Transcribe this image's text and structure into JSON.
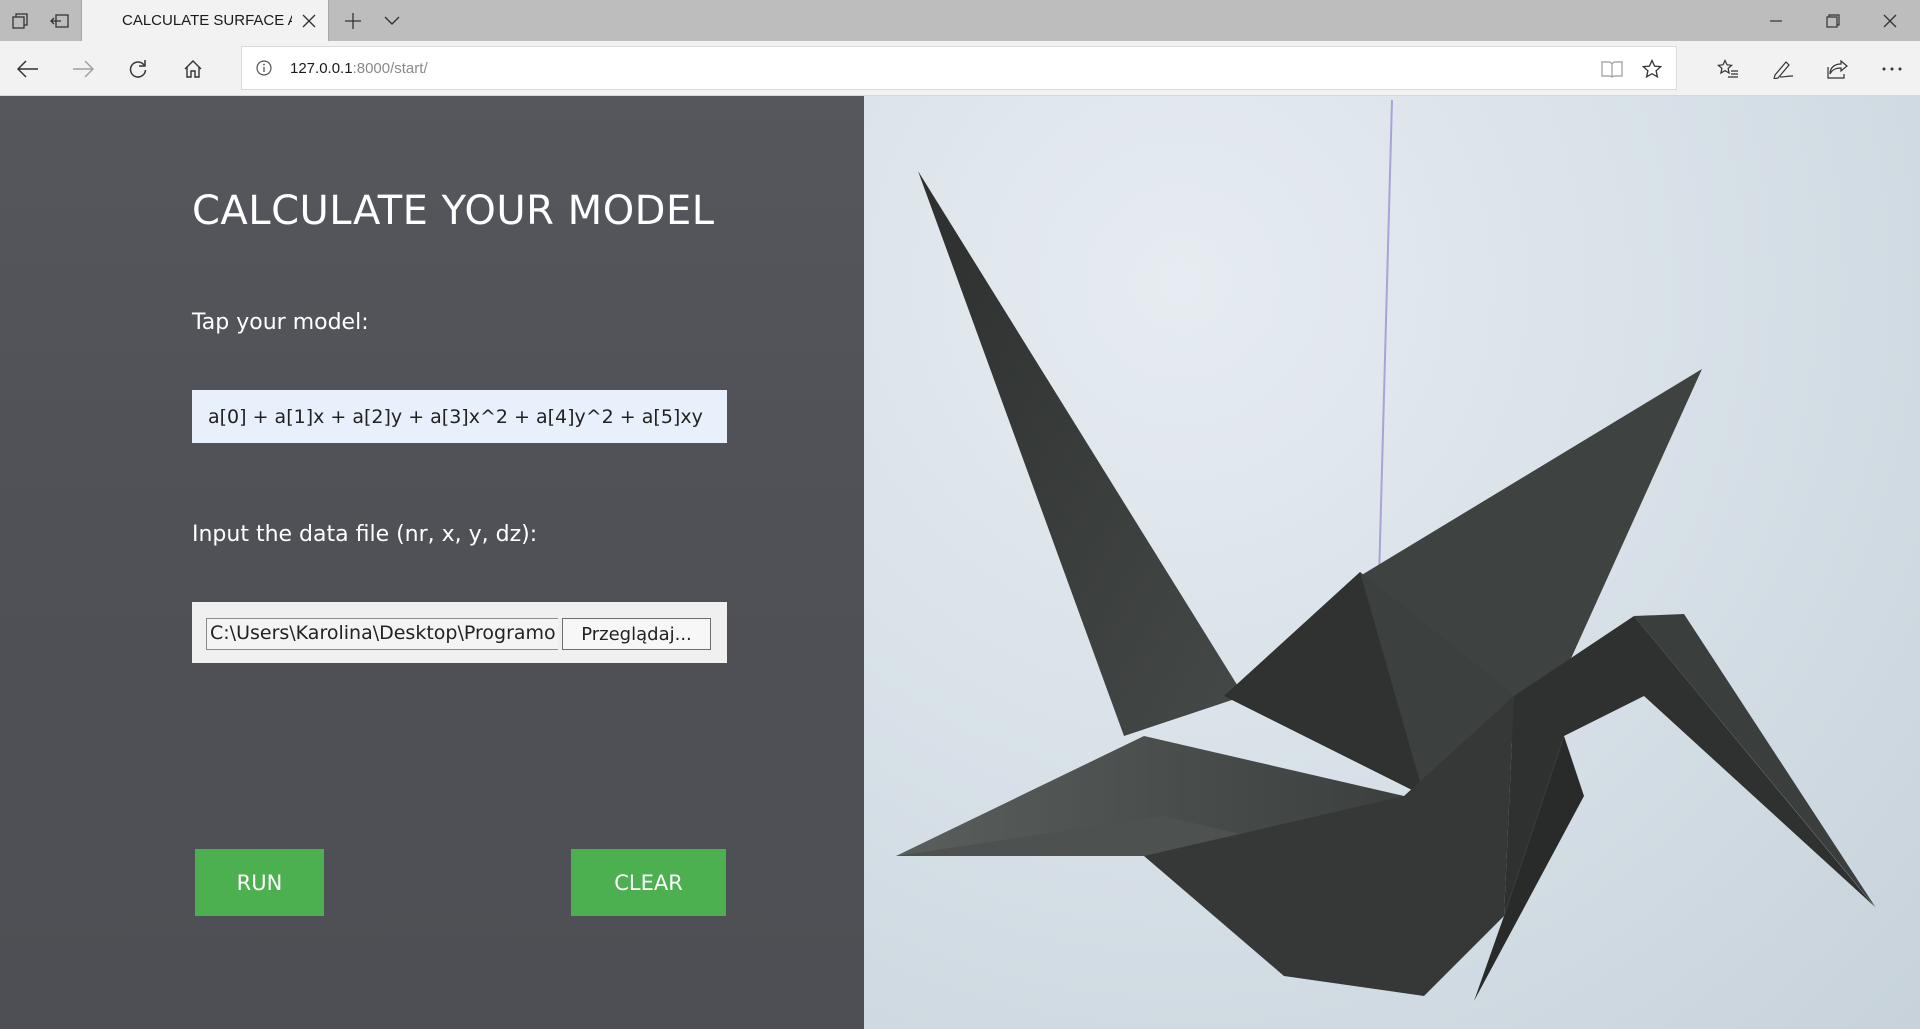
{
  "browser": {
    "tab_title": "CALCULATE SURFACE A",
    "url_host": "127.0.0.1",
    "url_rest": ":8000/start/",
    "icons": {
      "tab_actions": "tab-actions-icon",
      "set_aside": "set-aside-tabs-icon",
      "new_tab": "plus-icon",
      "tab_preview": "chevron-down-icon",
      "minimize": "minimize-icon",
      "restore": "restore-icon",
      "close": "close-icon",
      "back": "back-arrow-icon",
      "forward": "forward-arrow-icon",
      "refresh": "refresh-icon",
      "home": "home-icon",
      "info": "info-icon",
      "reading_view": "reading-view-icon",
      "favorite": "star-icon",
      "favorites_hub": "favorites-list-icon",
      "web_note": "pen-icon",
      "share": "share-icon",
      "more": "more-icon"
    }
  },
  "page": {
    "title": "CALCULATE YOUR MODEL",
    "model_label": "Tap your model:",
    "model_value": "a[0] + a[1]x + a[2]y + a[3]x^2 + a[4]y^2 + a[5]xy",
    "file_label": "Input the data file (nr, x, y, dz):",
    "file_path": "C:\\Users\\Karolina\\Desktop\\Programo",
    "browse_label": "Przeglądaj...",
    "run_label": "RUN",
    "clear_label": "CLEAR"
  },
  "colors": {
    "left_panel": "#4f5157",
    "button_green": "#4caf50",
    "input_bg": "#e8f0fb",
    "crane": "#3a3d3c"
  }
}
